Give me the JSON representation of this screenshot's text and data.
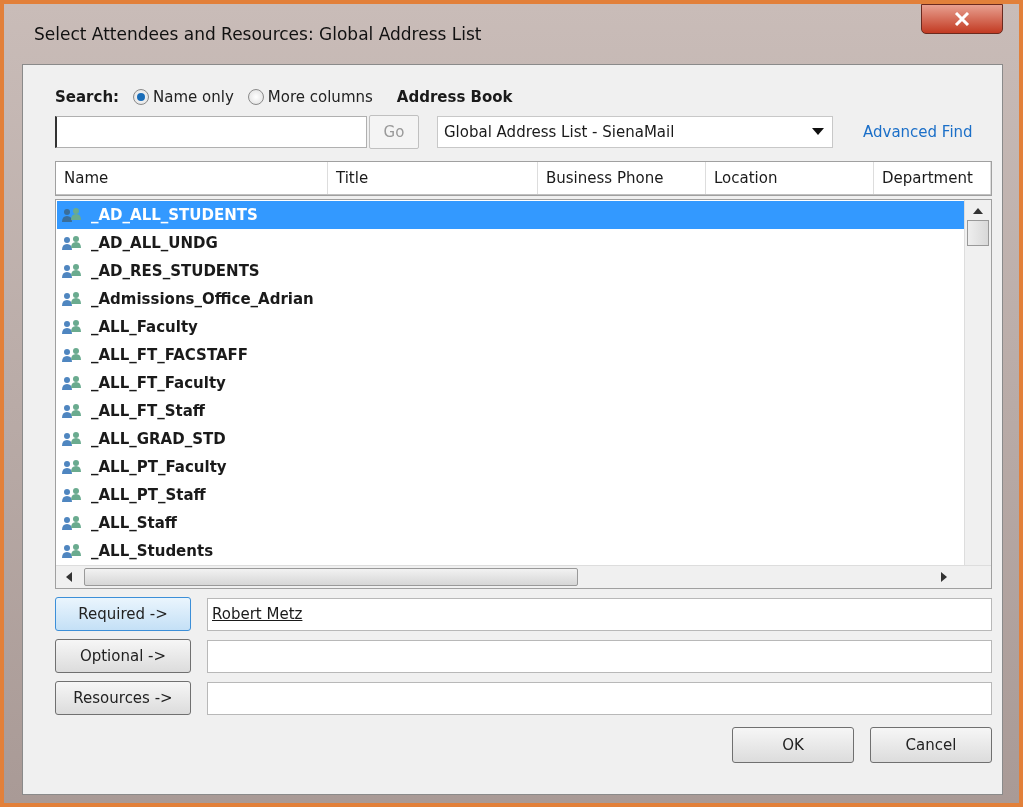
{
  "window": {
    "title": "Select Attendees and Resources: Global Address List"
  },
  "search": {
    "label": "Search:",
    "options": [
      {
        "label": "Name only",
        "selected": true
      },
      {
        "label": "More columns",
        "selected": false
      }
    ],
    "go_button": "Go"
  },
  "address_book": {
    "label": "Address Book",
    "value": "Global Address List - SienaMail",
    "advanced_find": "Advanced Find"
  },
  "table": {
    "columns": [
      "Name",
      "Title",
      "Business Phone",
      "Location",
      "Department"
    ],
    "rows": [
      {
        "name": "_AD_ALL_STUDENTS",
        "selected": true
      },
      {
        "name": "_AD_ALL_UNDG",
        "selected": false
      },
      {
        "name": "_AD_RES_STUDENTS",
        "selected": false
      },
      {
        "name": "_Admissions_Office_Adrian",
        "selected": false
      },
      {
        "name": "_ALL_Faculty",
        "selected": false
      },
      {
        "name": "_ALL_FT_FACSTAFF",
        "selected": false
      },
      {
        "name": "_ALL_FT_Faculty",
        "selected": false
      },
      {
        "name": "_ALL_FT_Staff",
        "selected": false
      },
      {
        "name": "_ALL_GRAD_STD",
        "selected": false
      },
      {
        "name": "_ALL_PT_Faculty",
        "selected": false
      },
      {
        "name": "_ALL_PT_Staff",
        "selected": false
      },
      {
        "name": "_ALL_Staff",
        "selected": false
      },
      {
        "name": "_ALL_Students",
        "selected": false
      }
    ]
  },
  "recipients": [
    {
      "button": "Required ->",
      "value": "Robert Metz",
      "focused": true
    },
    {
      "button": "Optional ->",
      "focused": false
    },
    {
      "button": "Resources ->",
      "focused": false
    }
  ],
  "buttons": [
    "OK",
    "Cancel"
  ]
}
